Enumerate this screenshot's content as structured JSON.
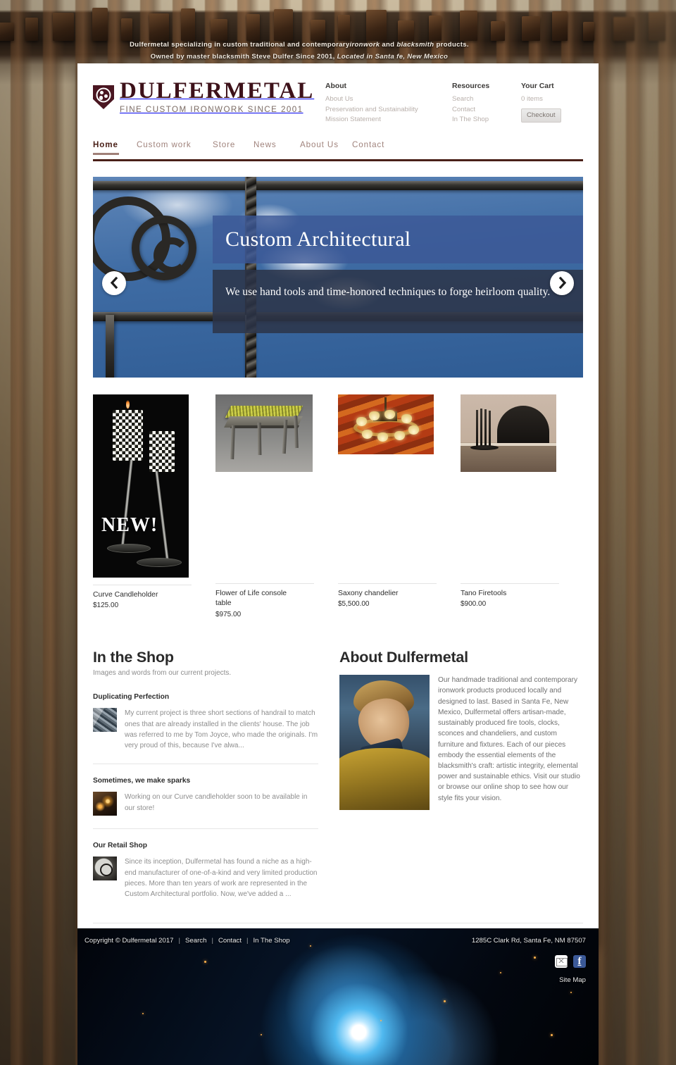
{
  "tagline": {
    "line1_a": "Dulfermetal specializing in custom traditional and contemporary",
    "line1_em": "ironwork",
    "line1_b": " and ",
    "line1_em2": "blacksmith",
    "line1_c": " products.",
    "line2_a": "Owned by master blacksmith Steve Dulfer Since 2001, ",
    "line2_em": "Located in Santa fe, New Mexico"
  },
  "logo": {
    "name": "DULFERMETAL",
    "subtitle": "FINE CUSTOM IRONWORK SINCE 2001",
    "icon": "shield-logo-icon"
  },
  "header_nav": {
    "about": {
      "title": "About",
      "links": [
        "About Us",
        "Preservation and Sustainability",
        "Mission Statement"
      ]
    },
    "resources": {
      "title": "Resources",
      "links": [
        "Search",
        "Contact",
        "In The Shop"
      ]
    },
    "cart": {
      "title": "Your Cart",
      "items_text": "0 items",
      "checkout_label": "Checkout"
    }
  },
  "main_nav": {
    "items": [
      {
        "label": "Home",
        "active": true
      },
      {
        "label": "Custom work",
        "active": false
      },
      {
        "label": "Store",
        "active": false
      },
      {
        "label": "News",
        "active": false
      },
      {
        "label": "About Us",
        "active": false
      },
      {
        "label": "Contact",
        "active": false
      }
    ]
  },
  "hero": {
    "title": "Custom Architectural",
    "subtitle": "We use hand tools and time-honored techniques to forge heirloom quality.",
    "prev_icon": "chevron-left-icon",
    "next_icon": "chevron-right-icon"
  },
  "products": [
    {
      "name": "Curve Candleholder",
      "price": "$125.00",
      "badge": "NEW!"
    },
    {
      "name": "Flower of Life console table",
      "price": "$975.00"
    },
    {
      "name": "Saxony chandelier",
      "price": "$5,500.00"
    },
    {
      "name": "Tano Firetools",
      "price": "$900.00"
    }
  ],
  "shop": {
    "title": "In the Shop",
    "subtitle": "Images and words from our current projects.",
    "posts": [
      {
        "title": "Duplicating Perfection",
        "body": "My current project is three short sections of handrail to match ones that are already installed in the clients' house.  The job was referred to me by Tom Joyce, who made the originals.  I'm very proud of this, because I've alwa...",
        "thumb": "handrail-thumb-icon"
      },
      {
        "title": "Sometimes, we make sparks",
        "body": "Working on our Curve candleholder soon to be available in our store!",
        "thumb": "sparks-thumb-icon"
      },
      {
        "title": "Our Retail Shop",
        "body": "Since its inception, Dulfermetal has found a niche as a high-end manufacturer of one-of-a-kind and very limited production pieces. More than ten years of work are represented in the Custom Architectural portfolio. Now, we've added a ...",
        "thumb": "logo-thumb-icon"
      }
    ]
  },
  "about": {
    "title": "About Dulfermetal",
    "body": "Our handmade traditional and contemporary ironwork products produced locally and designed to last. Based in Santa Fe, New Mexico, Dulfermetal offers artisan-made, sustainably produced fire tools, clocks, sconces and chandeliers, and custom furniture and fixtures. Each of our pieces embody the essential elements of the blacksmith's craft: artistic integrity, elemental power and sustainable ethics. Visit our studio or browse our online shop to see how our style fits your vision.",
    "photo": "blacksmith-portrait-photo"
  },
  "footer": {
    "copyright": "Copyright © Dulfermetal 2017",
    "links": [
      "Search",
      "Contact",
      "In The Shop"
    ],
    "address": "1285C Clark Rd, Santa Fe, NM 87507",
    "sitemap": "Site Map",
    "social": [
      {
        "name": "email-icon",
        "glyph": ""
      },
      {
        "name": "facebook-icon",
        "glyph": "f"
      }
    ]
  },
  "colors": {
    "brand_maroon": "#4a1621",
    "nav_underline": "#4a2018",
    "hero_band_blue": "#3c5896",
    "hero_sub_band": "#2c3448",
    "facebook_blue": "#3b5998"
  }
}
